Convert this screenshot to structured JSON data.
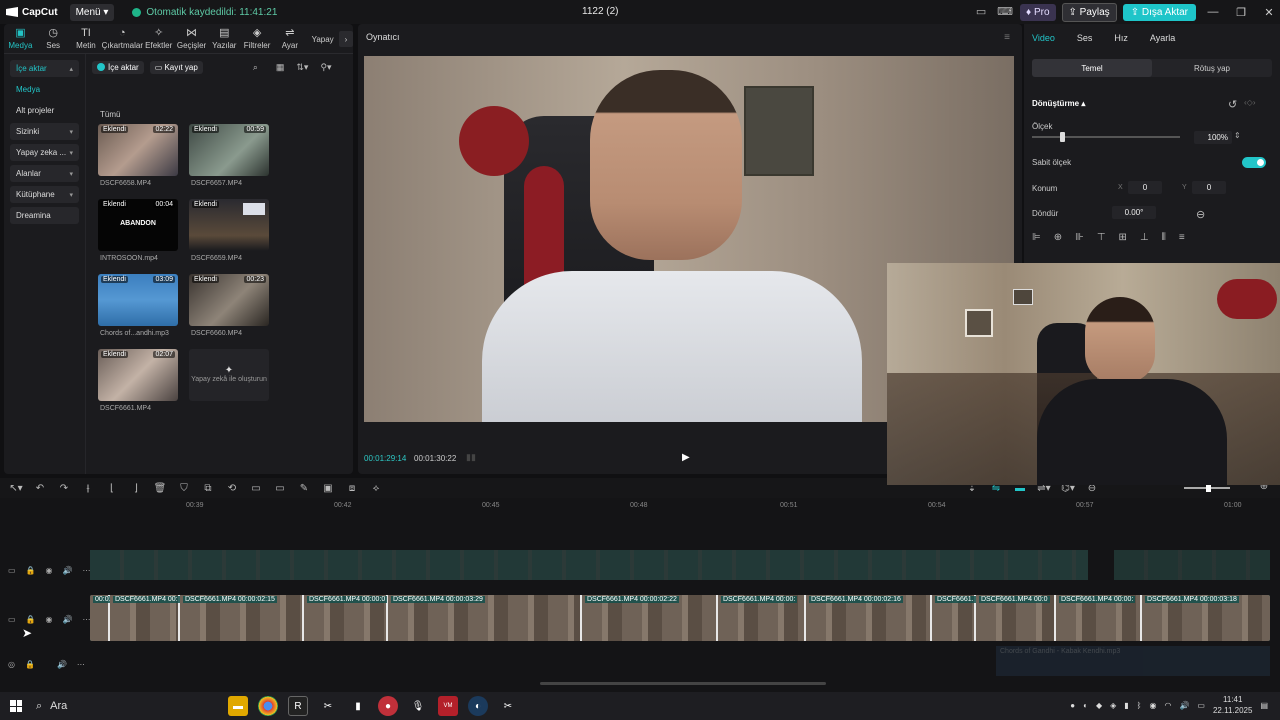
{
  "titlebar": {
    "app_name": "CapCut",
    "menu_label": "Menü",
    "autosave": "Otomatik kaydedildi: 11:41:21",
    "project_title": "1122 (2)",
    "pro_label": "Pro",
    "share_label": "Paylaş",
    "export_label": "Dışa Aktar"
  },
  "tabs": [
    {
      "label": "Medya",
      "icon": "▣"
    },
    {
      "label": "Ses",
      "icon": "◷"
    },
    {
      "label": "Metin",
      "icon": "TI"
    },
    {
      "label": "Çıkartmalar",
      "icon": "◔"
    },
    {
      "label": "Efektler",
      "icon": "✧"
    },
    {
      "label": "Geçişler",
      "icon": "⋈"
    },
    {
      "label": "Yazılar",
      "icon": "▤"
    },
    {
      "label": "Filtreler",
      "icon": "◈"
    },
    {
      "label": "Ayar",
      "icon": "⇌"
    },
    {
      "label": "Yapay",
      "icon": ""
    }
  ],
  "sidenav": {
    "import": "İçe aktar",
    "media": "Medya",
    "subprojects": "Alt projeler",
    "yours": "Sizinki",
    "ai": "Yapay zeka ...",
    "spaces": "Alanlar",
    "library": "Kütüphane",
    "dreamina": "Dreamina"
  },
  "media": {
    "import_btn": "İçe aktar",
    "record_btn": "Kayıt yap",
    "all_label": "Tümü",
    "added": "Eklendi",
    "items": [
      {
        "name": "DSCF6658.MP4",
        "dur": "02:22"
      },
      {
        "name": "DSCF6657.MP4",
        "dur": "00:59"
      },
      {
        "name": "INTROSOON.mp4",
        "dur": "00:04"
      },
      {
        "name": "DSCF6659.MP4",
        "dur": ""
      },
      {
        "name": "Chords of...andhi.mp3",
        "dur": "03:09"
      },
      {
        "name": "DSCF6660.MP4",
        "dur": "00:23"
      },
      {
        "name": "DSCF6661.MP4",
        "dur": "02:07"
      }
    ],
    "abandon_text": "ABANDON",
    "ai_create": "Yapay zekâ ile oluşturun"
  },
  "player": {
    "title": "Oynatıcı",
    "current_time": "00:01:29:14",
    "total_time": "00:01:30:22"
  },
  "inspector": {
    "tabs": [
      "Video",
      "Ses",
      "Hız",
      "Ayarla"
    ],
    "subtabs": [
      "Temel",
      "Rötuş yap"
    ],
    "transform": "Dönüştürme",
    "scale_label": "Ölçek",
    "scale_value": "100%",
    "uniform_scale": "Sabit ölçek",
    "position_label": "Konum",
    "pos_x_axis": "X",
    "pos_x": "0",
    "pos_y_axis": "Y",
    "pos_y": "0",
    "rotate_label": "Döndür",
    "rotate_value": "0.00°"
  },
  "timeline": {
    "ticks": [
      "00:39",
      "00:42",
      "00:45",
      "00:48",
      "00:51",
      "00:54",
      "00:57",
      "01:00"
    ],
    "clips": [
      {
        "label": "00:01:"
      },
      {
        "label": "DSCF6661.MP4  00:"
      },
      {
        "label": "DSCF6661.MP4  00:00:02:15"
      },
      {
        "label": "DSCF6661.MP4  00:00:0"
      },
      {
        "label": "DSCF6661.MP4  00:00:03:29"
      },
      {
        "label": "DSCF6661.MP4  00:00:02:22"
      },
      {
        "label": "DSCF6661.MP4  00:00:"
      },
      {
        "label": "DSCF6661.MP4  00:00:02:16"
      },
      {
        "label": "DSCF6661."
      },
      {
        "label": "DSCF6661.MP4  00:0"
      },
      {
        "label": "DSCF6661.MP4  00:00:"
      },
      {
        "label": "DSCF6661.MP4  00:00:03:18"
      }
    ],
    "audio_label": "Chords of Gandhi - Kabak Kendhi.mp3"
  },
  "taskbar": {
    "search": "Ara",
    "time": "11:41",
    "date": "22.11.2025"
  }
}
